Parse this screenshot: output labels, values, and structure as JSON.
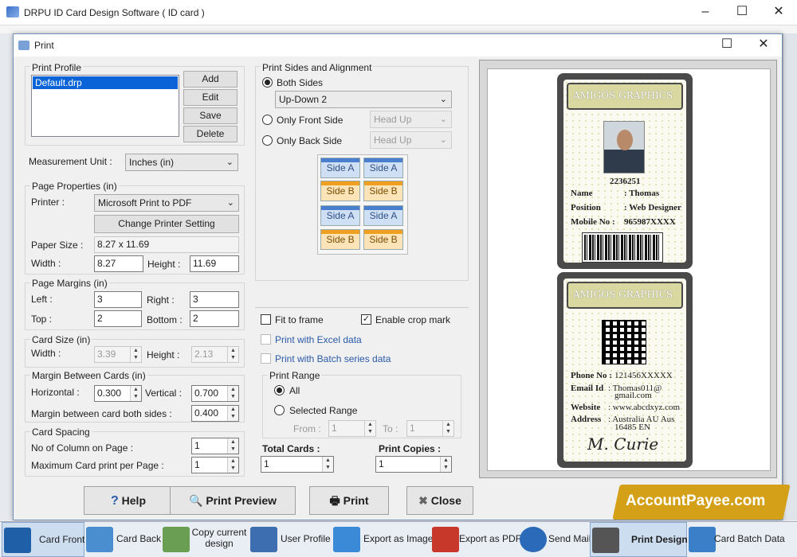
{
  "app": {
    "title": "DRPU ID Card Design Software ( ID card )"
  },
  "dialog": {
    "title": "Print"
  },
  "print_profile": {
    "title": "Print Profile",
    "items": [
      "Default.drp"
    ],
    "add": "Add",
    "edit": "Edit",
    "save": "Save",
    "delete": "Delete"
  },
  "measurement": {
    "label": "Measurement Unit :",
    "value": "Inches (in)"
  },
  "page_props": {
    "title": "Page Properties (in)",
    "printer_label": "Printer :",
    "printer_value": "Microsoft Print to PDF",
    "change_btn": "Change Printer Setting",
    "paper_label": "Paper Size :",
    "paper_value": "8.27 x 11.69",
    "width_label": "Width :",
    "width_value": "8.27",
    "height_label": "Height :",
    "height_value": "11.69"
  },
  "margins": {
    "title": "Page Margins (in)",
    "left_label": "Left :",
    "left_value": "3",
    "right_label": "Right :",
    "right_value": "3",
    "top_label": "Top :",
    "top_value": "2",
    "bottom_label": "Bottom :",
    "bottom_value": "2"
  },
  "card_size": {
    "title": "Card Size (in)",
    "width_label": "Width :",
    "width_value": "3.39",
    "height_label": "Height :",
    "height_value": "2.13"
  },
  "between": {
    "title": "Margin Between Cards (in)",
    "h_label": "Horizontal :",
    "h_value": "0.300",
    "v_label": "Vertical :",
    "v_value": "0.700",
    "both_label": "Margin between card both sides :",
    "both_value": "0.400"
  },
  "spacing": {
    "title": "Card Spacing",
    "cols_label": "No of Column on Page :",
    "cols_value": "1",
    "max_label": "Maximum Card print per Page :",
    "max_value": "1"
  },
  "sides": {
    "title": "Print Sides and Alignment",
    "both": "Both Sides",
    "both_select": "Up-Down 2",
    "front": "Only Front Side",
    "front_select": "Head Up",
    "back": "Only Back Side",
    "back_select": "Head Up",
    "grid": [
      [
        "Side A",
        "Side A"
      ],
      [
        "Side B",
        "Side B"
      ],
      [
        "Side A",
        "Side A"
      ],
      [
        "Side B",
        "Side B"
      ]
    ]
  },
  "options": {
    "fit": "Fit to frame",
    "crop": "Enable crop mark",
    "excel": "Print with Excel data",
    "batch": "Print with Batch series data"
  },
  "range": {
    "title": "Print Range",
    "all": "All",
    "selected": "Selected Range",
    "from_label": "From :",
    "from_value": "1",
    "to_label": "To :",
    "to_value": "1"
  },
  "totals": {
    "cards_label": "Total Cards :",
    "cards_value": "1",
    "copies_label": "Print Copies :",
    "copies_value": "1"
  },
  "buttons": {
    "help": "Help",
    "preview": "Print Preview",
    "print": "Print",
    "close": "Close"
  },
  "watermark": "AccountPayee.com",
  "card_front": {
    "company": "AMIGOS GRAPHICS",
    "id": "2236251",
    "name_label": "Name",
    "name": ": Thomas",
    "position_label": "Position",
    "position": ": Web Designer",
    "mobile_label": "Mobile No :",
    "mobile": "965987XXXX"
  },
  "card_back": {
    "company": "AMIGOS GRAPHICS",
    "phone_label": "Phone No :",
    "phone": "121456XXXXX",
    "email_label": "Email Id",
    "email": ": Thomas011@",
    "email2": "gmail.com",
    "website_label": "Website",
    "website": ": www.abcdxyz.com",
    "address_label": "Address",
    "address": ": Australia AU Aus",
    "address2": "16485 EN",
    "signature": "M. Curie"
  },
  "taskbar": [
    "Card Front",
    "Card Back",
    "Copy current design",
    "User Profile",
    "Export as Image",
    "Export as PDF",
    "Send Mail",
    "Print Design",
    "Card Batch Data"
  ],
  "colors": {
    "accent": "#6f8fb8",
    "watermark_bg": "#d4a017",
    "card_frame": "#4a4a4a",
    "card_header": "#d8d8a0"
  }
}
